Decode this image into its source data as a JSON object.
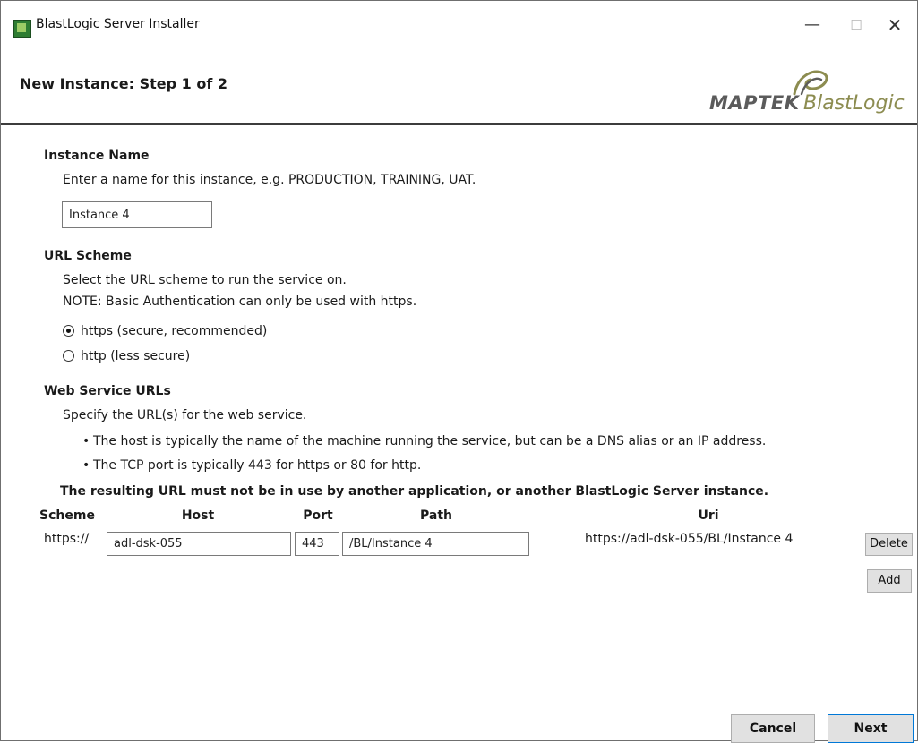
{
  "window": {
    "title": "BlastLogic Server Installer",
    "minimize": "—",
    "maximize": "☐",
    "close": "✕"
  },
  "header": {
    "step_title": "New Instance: Step 1 of 2",
    "logo_primary": "MAPTEK",
    "logo_secondary": "BlastLogic",
    "logo_colors": {
      "maptek": "#5b5b5b",
      "blastlogic": "#8c8c50"
    }
  },
  "instance_name": {
    "heading": "Instance Name",
    "description": "Enter a name for this instance, e.g. PRODUCTION, TRAINING, UAT.",
    "value": "Instance 4"
  },
  "url_scheme": {
    "heading": "URL Scheme",
    "description": "Select the URL scheme to run the service on.",
    "note": "NOTE: Basic Authentication can only be used with https.",
    "options": [
      {
        "label": "https (secure, recommended)",
        "checked": true
      },
      {
        "label": "http (less secure)",
        "checked": false
      }
    ]
  },
  "web_service": {
    "heading": "Web Service URLs",
    "description": "Specify the URL(s) for the web service.",
    "bullets": [
      "The host is typically the name of the machine running the service, but can be a DNS alias or an IP address.",
      "The TCP port is typically 443 for https or 80 for http."
    ],
    "warning": "The resulting URL must not be in use by another application, or another BlastLogic Server instance.",
    "columns": {
      "scheme": "Scheme",
      "host": "Host",
      "port": "Port",
      "path": "Path",
      "uri": "Uri"
    },
    "rows": [
      {
        "scheme": "https://",
        "host": "adl-dsk-055",
        "port": "443",
        "path": "/BL/Instance 4",
        "uri": "https://adl-dsk-055/BL/Instance 4",
        "delete_label": "Delete"
      }
    ],
    "add_label": "Add"
  },
  "footer": {
    "cancel_label": "Cancel",
    "next_label": "Next"
  }
}
